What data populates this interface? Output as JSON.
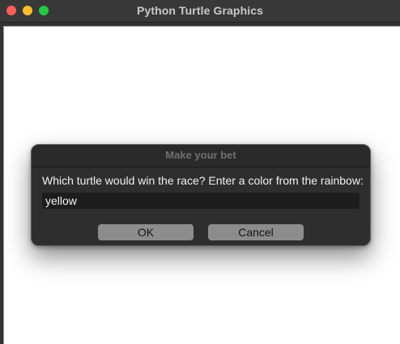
{
  "window": {
    "title": "Python Turtle Graphics",
    "controls": [
      "close",
      "minimize",
      "zoom"
    ]
  },
  "dialog": {
    "title": "Make your bet",
    "prompt": "Which turtle would win the race? Enter a color from the rainbow:",
    "input_value": "yellow",
    "ok_label": "OK",
    "cancel_label": "Cancel"
  },
  "colors": {
    "close": "#fe5f57",
    "minimize": "#febc2e",
    "zoom": "#28c840",
    "canvas": "#ffffff",
    "dialog_bg": "#2e2e2e",
    "button_bg": "#8c8c8c"
  }
}
